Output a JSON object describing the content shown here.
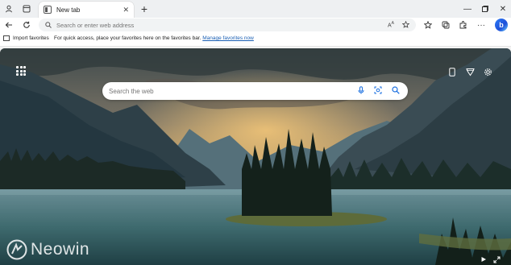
{
  "tabbar": {
    "tab_label": "New tab"
  },
  "address_bar": {
    "placeholder": "Search or enter web address"
  },
  "favorites_bar": {
    "import_label": "Import favorites",
    "message": "For quick access, place your favorites here on the favorites bar.",
    "link": "Manage favorites now"
  },
  "content": {
    "search_placeholder": "Search the web",
    "watermark": "Neowin"
  },
  "colors": {
    "accent": "#1a5fb4",
    "tab_strip": "#eef0f2"
  }
}
